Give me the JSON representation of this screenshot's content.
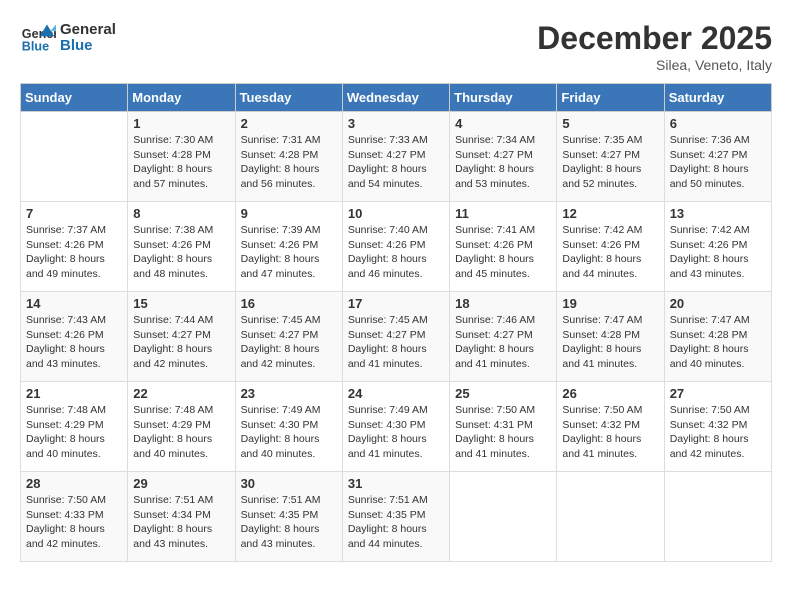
{
  "header": {
    "logo_line1": "General",
    "logo_line2": "Blue",
    "month": "December 2025",
    "location": "Silea, Veneto, Italy"
  },
  "weekdays": [
    "Sunday",
    "Monday",
    "Tuesday",
    "Wednesday",
    "Thursday",
    "Friday",
    "Saturday"
  ],
  "weeks": [
    [
      {
        "day": "",
        "info": ""
      },
      {
        "day": "1",
        "info": "Sunrise: 7:30 AM\nSunset: 4:28 PM\nDaylight: 8 hours\nand 57 minutes."
      },
      {
        "day": "2",
        "info": "Sunrise: 7:31 AM\nSunset: 4:28 PM\nDaylight: 8 hours\nand 56 minutes."
      },
      {
        "day": "3",
        "info": "Sunrise: 7:33 AM\nSunset: 4:27 PM\nDaylight: 8 hours\nand 54 minutes."
      },
      {
        "day": "4",
        "info": "Sunrise: 7:34 AM\nSunset: 4:27 PM\nDaylight: 8 hours\nand 53 minutes."
      },
      {
        "day": "5",
        "info": "Sunrise: 7:35 AM\nSunset: 4:27 PM\nDaylight: 8 hours\nand 52 minutes."
      },
      {
        "day": "6",
        "info": "Sunrise: 7:36 AM\nSunset: 4:27 PM\nDaylight: 8 hours\nand 50 minutes."
      }
    ],
    [
      {
        "day": "7",
        "info": "Sunrise: 7:37 AM\nSunset: 4:26 PM\nDaylight: 8 hours\nand 49 minutes."
      },
      {
        "day": "8",
        "info": "Sunrise: 7:38 AM\nSunset: 4:26 PM\nDaylight: 8 hours\nand 48 minutes."
      },
      {
        "day": "9",
        "info": "Sunrise: 7:39 AM\nSunset: 4:26 PM\nDaylight: 8 hours\nand 47 minutes."
      },
      {
        "day": "10",
        "info": "Sunrise: 7:40 AM\nSunset: 4:26 PM\nDaylight: 8 hours\nand 46 minutes."
      },
      {
        "day": "11",
        "info": "Sunrise: 7:41 AM\nSunset: 4:26 PM\nDaylight: 8 hours\nand 45 minutes."
      },
      {
        "day": "12",
        "info": "Sunrise: 7:42 AM\nSunset: 4:26 PM\nDaylight: 8 hours\nand 44 minutes."
      },
      {
        "day": "13",
        "info": "Sunrise: 7:42 AM\nSunset: 4:26 PM\nDaylight: 8 hours\nand 43 minutes."
      }
    ],
    [
      {
        "day": "14",
        "info": "Sunrise: 7:43 AM\nSunset: 4:26 PM\nDaylight: 8 hours\nand 43 minutes."
      },
      {
        "day": "15",
        "info": "Sunrise: 7:44 AM\nSunset: 4:27 PM\nDaylight: 8 hours\nand 42 minutes."
      },
      {
        "day": "16",
        "info": "Sunrise: 7:45 AM\nSunset: 4:27 PM\nDaylight: 8 hours\nand 42 minutes."
      },
      {
        "day": "17",
        "info": "Sunrise: 7:45 AM\nSunset: 4:27 PM\nDaylight: 8 hours\nand 41 minutes."
      },
      {
        "day": "18",
        "info": "Sunrise: 7:46 AM\nSunset: 4:27 PM\nDaylight: 8 hours\nand 41 minutes."
      },
      {
        "day": "19",
        "info": "Sunrise: 7:47 AM\nSunset: 4:28 PM\nDaylight: 8 hours\nand 41 minutes."
      },
      {
        "day": "20",
        "info": "Sunrise: 7:47 AM\nSunset: 4:28 PM\nDaylight: 8 hours\nand 40 minutes."
      }
    ],
    [
      {
        "day": "21",
        "info": "Sunrise: 7:48 AM\nSunset: 4:29 PM\nDaylight: 8 hours\nand 40 minutes."
      },
      {
        "day": "22",
        "info": "Sunrise: 7:48 AM\nSunset: 4:29 PM\nDaylight: 8 hours\nand 40 minutes."
      },
      {
        "day": "23",
        "info": "Sunrise: 7:49 AM\nSunset: 4:30 PM\nDaylight: 8 hours\nand 40 minutes."
      },
      {
        "day": "24",
        "info": "Sunrise: 7:49 AM\nSunset: 4:30 PM\nDaylight: 8 hours\nand 41 minutes."
      },
      {
        "day": "25",
        "info": "Sunrise: 7:50 AM\nSunset: 4:31 PM\nDaylight: 8 hours\nand 41 minutes."
      },
      {
        "day": "26",
        "info": "Sunrise: 7:50 AM\nSunset: 4:32 PM\nDaylight: 8 hours\nand 41 minutes."
      },
      {
        "day": "27",
        "info": "Sunrise: 7:50 AM\nSunset: 4:32 PM\nDaylight: 8 hours\nand 42 minutes."
      }
    ],
    [
      {
        "day": "28",
        "info": "Sunrise: 7:50 AM\nSunset: 4:33 PM\nDaylight: 8 hours\nand 42 minutes."
      },
      {
        "day": "29",
        "info": "Sunrise: 7:51 AM\nSunset: 4:34 PM\nDaylight: 8 hours\nand 43 minutes."
      },
      {
        "day": "30",
        "info": "Sunrise: 7:51 AM\nSunset: 4:35 PM\nDaylight: 8 hours\nand 43 minutes."
      },
      {
        "day": "31",
        "info": "Sunrise: 7:51 AM\nSunset: 4:35 PM\nDaylight: 8 hours\nand 44 minutes."
      },
      {
        "day": "",
        "info": ""
      },
      {
        "day": "",
        "info": ""
      },
      {
        "day": "",
        "info": ""
      }
    ]
  ]
}
